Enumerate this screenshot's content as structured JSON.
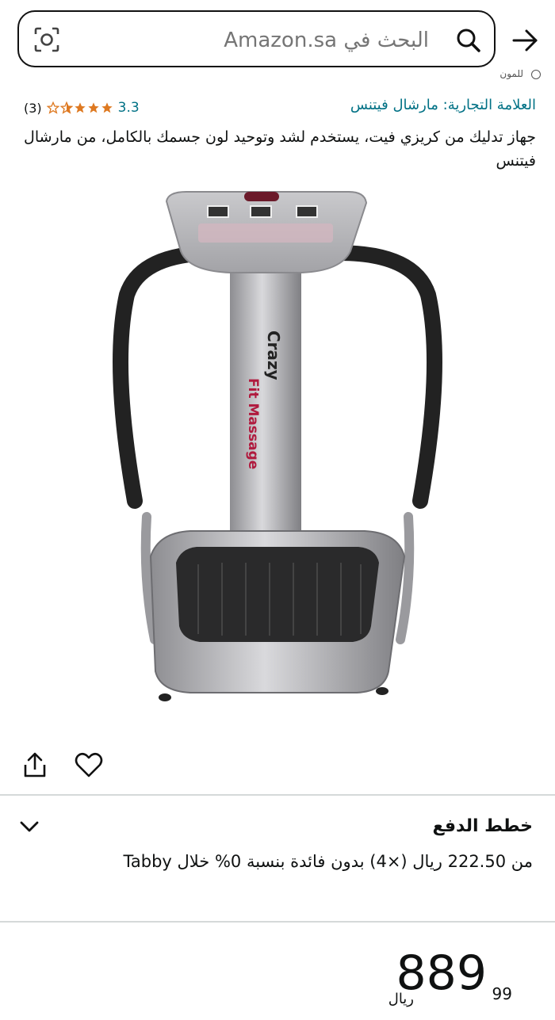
{
  "search": {
    "placeholder": "البحث في Amazon.sa"
  },
  "header": {
    "clipped_text": "للمون"
  },
  "product": {
    "brand": "العلامة التجارية: مارشال فيتنس",
    "rating": "3.3",
    "rating_count": "(3)",
    "stars_filled": 3.3,
    "title": "جهاز تدليك من كريزي فيت، يستخدم لشد وتوحيد لون جسمك بالكامل، من مارشال فيتنس",
    "image_text_1": "Crazy",
    "image_text_2": "Fit Massage"
  },
  "payment": {
    "title": "خطط الدفع",
    "description": "من 222.50 ريال (×4) بدون فائدة بنسبة 0% خلال Tabby"
  },
  "price": {
    "whole": "889",
    "fraction": "99",
    "currency": "ريال"
  },
  "colors": {
    "link": "#007185",
    "star": "#de7921",
    "divider": "#d5d9d9"
  }
}
